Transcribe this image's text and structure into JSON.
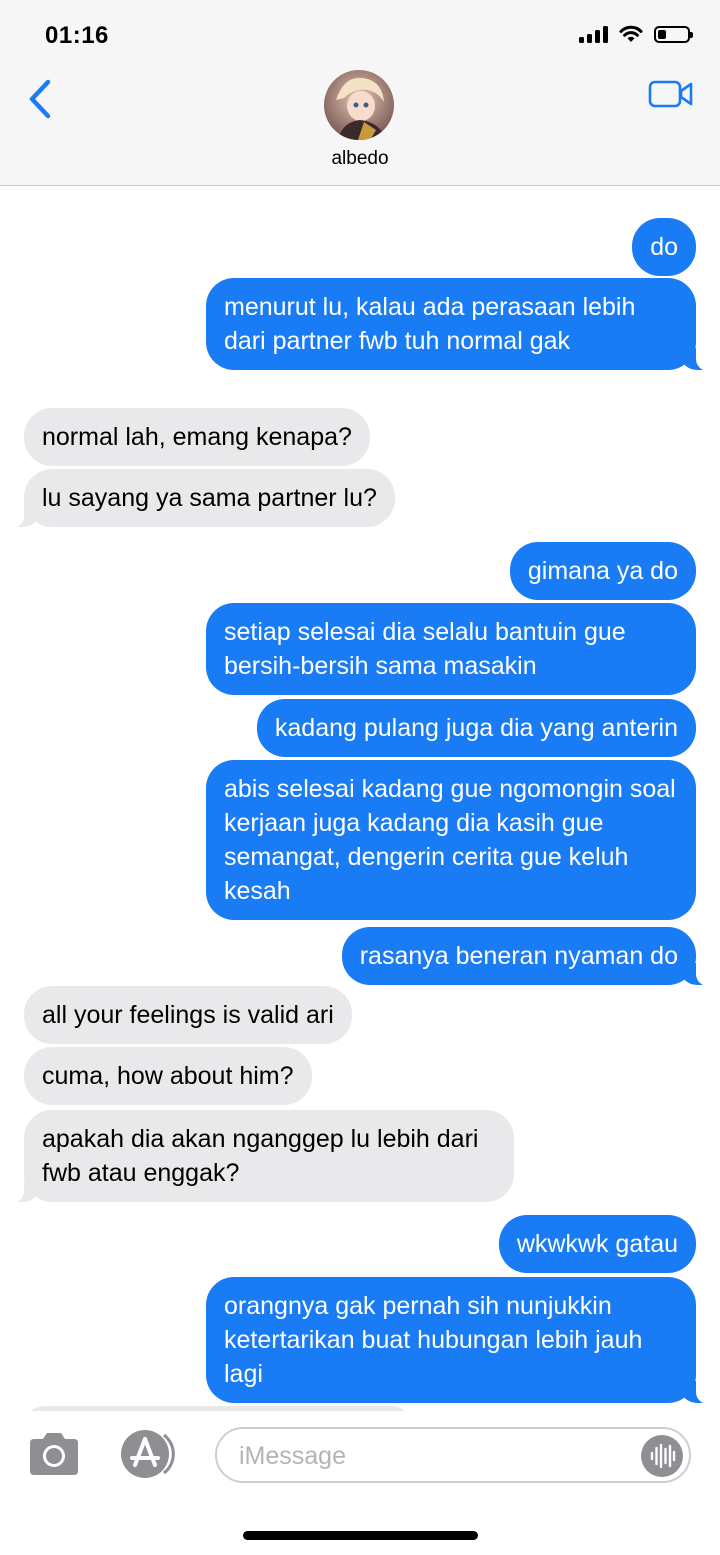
{
  "status_bar": {
    "time": "01:16",
    "battery_level": 0.3
  },
  "header": {
    "contact_name": "albedo"
  },
  "messages": [
    {
      "from": "me",
      "text": "do"
    },
    {
      "from": "me",
      "text": "menurut lu, kalau ada perasaan lebih dari partner fwb tuh normal gak"
    },
    {
      "from": "them",
      "text": "normal lah, emang kenapa?"
    },
    {
      "from": "them",
      "text": "lu sayang ya sama partner lu?"
    },
    {
      "from": "me",
      "text": "gimana ya do"
    },
    {
      "from": "me",
      "text": "setiap selesai dia selalu bantuin gue bersih-bersih sama masakin"
    },
    {
      "from": "me",
      "text": "kadang pulang juga dia yang anterin"
    },
    {
      "from": "me",
      "text": "abis selesai kadang gue ngomongin soal kerjaan juga kadang dia kasih gue semangat, dengerin cerita gue keluh kesah"
    },
    {
      "from": "me",
      "text": "rasanya beneran nyaman do"
    },
    {
      "from": "them",
      "text": "all your feelings is valid ari"
    },
    {
      "from": "them",
      "text": "cuma, how about him?"
    },
    {
      "from": "them",
      "text": "apakah dia akan nganggep lu lebih dari fwb atau enggak?"
    },
    {
      "from": "me",
      "text": "wkwkwk gatau"
    },
    {
      "from": "me",
      "text": "orangnya gak pernah sih nunjukkin ketertarikan buat hubungan lebih jauh lagi"
    }
  ],
  "input": {
    "placeholder": "iMessage",
    "value": ""
  },
  "colors": {
    "outgoing": "#1a7cf5",
    "incoming": "#e9e9eb",
    "accent": "#1a7cf5"
  },
  "icons": [
    "back-chevron-icon",
    "video-camera-icon",
    "camera-icon",
    "app-store-icon",
    "audio-waveform-icon"
  ]
}
